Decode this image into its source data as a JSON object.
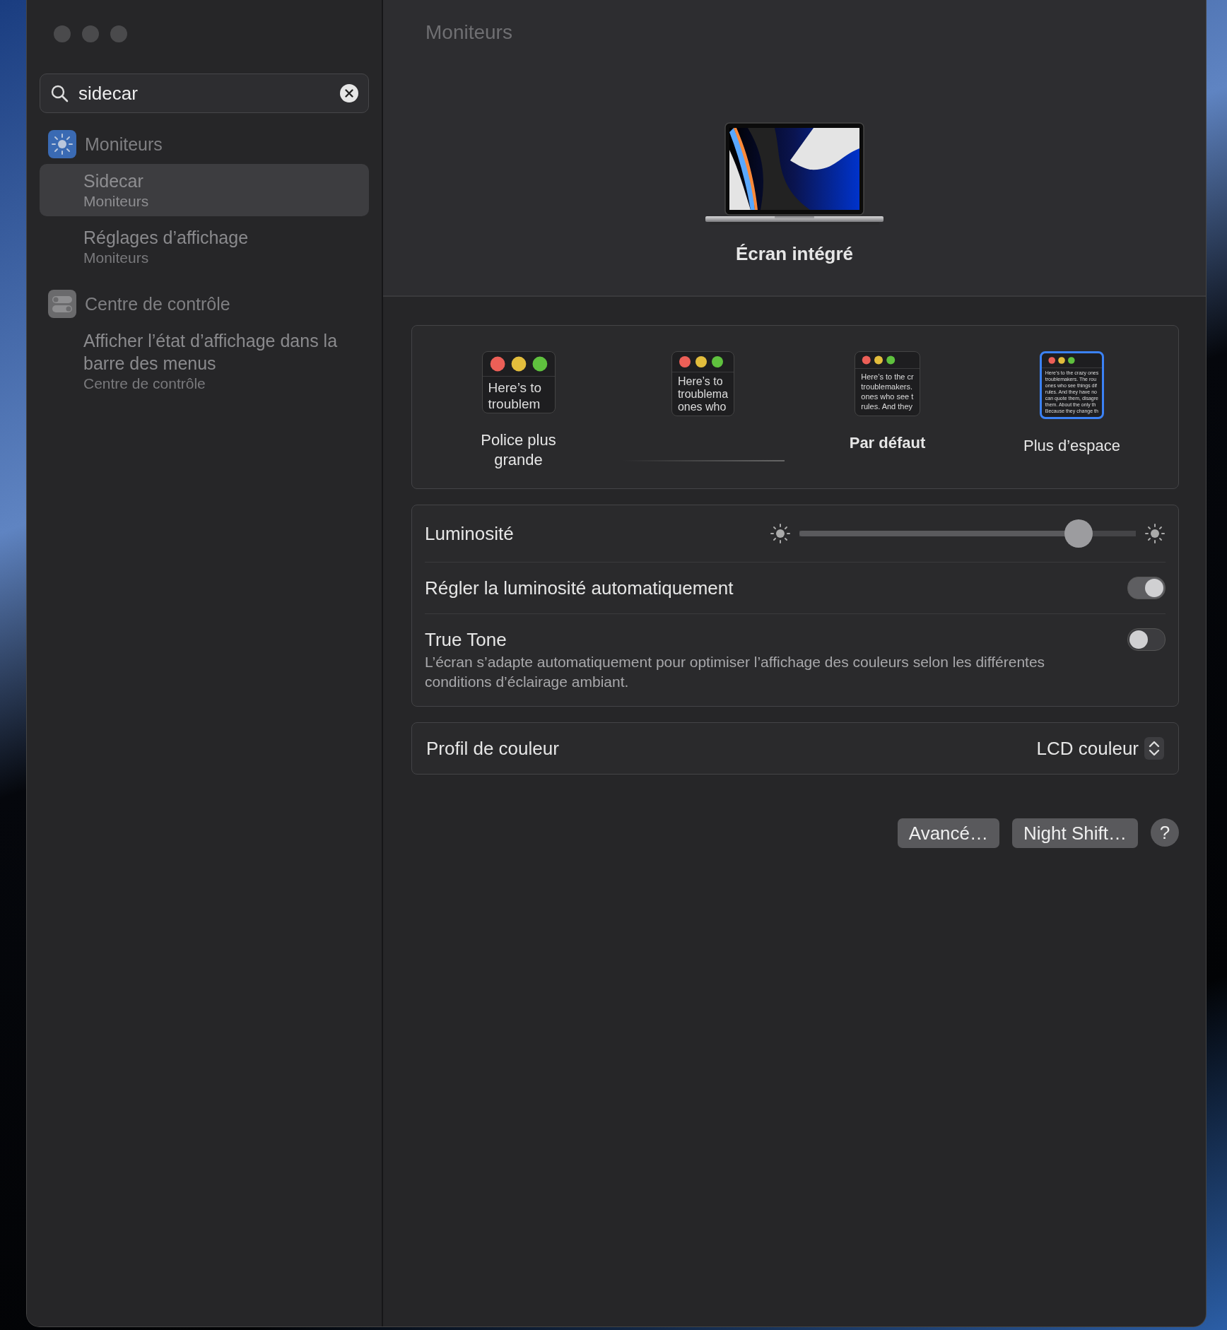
{
  "window": {
    "title": "Moniteurs"
  },
  "search": {
    "value": "sidecar"
  },
  "sidebar": {
    "groups": [
      {
        "title": "Moniteurs",
        "items": [
          {
            "title": "Sidecar",
            "subtitle": "Moniteurs",
            "selected": true
          },
          {
            "title": "Réglages d’affichage",
            "subtitle": "Moniteurs",
            "selected": false
          }
        ]
      },
      {
        "title": "Centre de contrôle",
        "items": [
          {
            "title": "Afficher l’état d’affichage dans la barre des menus",
            "subtitle": "Centre de contrôle",
            "selected": false
          }
        ]
      }
    ]
  },
  "display": {
    "name": "Écran intégré"
  },
  "resolutions": [
    {
      "label": "Police plus grande",
      "is_default": false,
      "selected": false,
      "preview": [
        "Here’s to",
        "troublem"
      ]
    },
    {
      "selected": false,
      "preview": [
        "Here’s to",
        "troublema",
        "ones who"
      ]
    },
    {
      "label": "Par défaut",
      "is_default": true,
      "selected": false,
      "preview": [
        "Here’s to the cr",
        "troublemakers.",
        "ones who see t",
        "rules. And they"
      ]
    },
    {
      "label": "Plus d’espace",
      "is_default": false,
      "selected": true,
      "preview": [
        "Here’s to the crazy ones",
        "troublemakers. The rou",
        "ones who see things dif",
        "rules. And they have no",
        "can quote them, disagre",
        "them. About the only th",
        "Because they change th"
      ]
    }
  ],
  "settings": [
    {
      "kind": "slider",
      "label": "Luminosité",
      "level": 0.83
    },
    {
      "kind": "toggle",
      "label": "Régler la luminosité automatiquement",
      "on": true
    },
    {
      "kind": "toggle",
      "label": "True Tone",
      "on": false,
      "description": "L’écran s’adapte automatiquement pour optimiser l’affichage des couleurs selon les différentes conditions d’éclairage ambiant."
    }
  ],
  "color_profile": {
    "label": "Profil de couleur",
    "value": "LCD couleur"
  },
  "buttons": [
    {
      "kind": "text",
      "label": "Avancé…"
    },
    {
      "kind": "text",
      "label": "Night Shift…"
    },
    {
      "kind": "help",
      "label": "?"
    }
  ]
}
